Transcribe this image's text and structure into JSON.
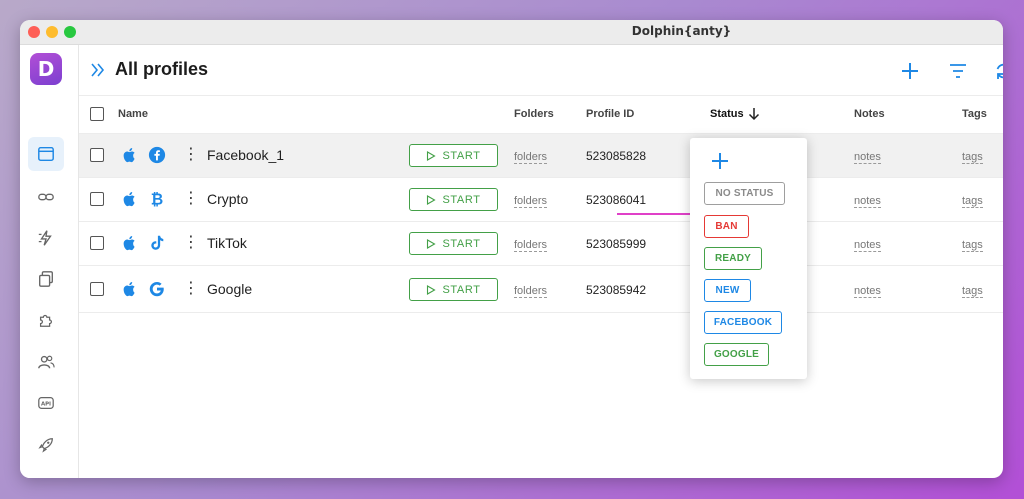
{
  "window": {
    "title": "Dolphin{anty}"
  },
  "sidebar": {
    "logo_letter": "D",
    "items": [
      {
        "icon": "browser-profiles-icon"
      },
      {
        "icon": "link-icon"
      },
      {
        "icon": "automation-icon"
      },
      {
        "icon": "copy-icon"
      },
      {
        "icon": "extension-icon"
      },
      {
        "icon": "users-icon"
      },
      {
        "icon": "api-icon",
        "label": "API"
      },
      {
        "icon": "rocket-icon"
      },
      {
        "icon": "settings-icon"
      }
    ]
  },
  "header": {
    "title": "All profiles"
  },
  "table": {
    "columns": {
      "name": "Name",
      "folders": "Folders",
      "profile_id": "Profile ID",
      "status": "Status",
      "notes": "Notes",
      "tags": "Tags"
    },
    "rows": [
      {
        "name": "Facebook_1",
        "site_icon": "facebook-icon",
        "os_icon": "apple-icon",
        "start": "START",
        "folders": "folders",
        "profile_id": "523085828",
        "notes": "notes",
        "tags": "tags"
      },
      {
        "name": "Crypto",
        "site_icon": "bitcoin-icon",
        "os_icon": "apple-icon",
        "start": "START",
        "folders": "folders",
        "profile_id": "523086041",
        "notes": "notes",
        "tags": "tags"
      },
      {
        "name": "TikTok",
        "site_icon": "tiktok-icon",
        "os_icon": "apple-icon",
        "start": "START",
        "folders": "folders",
        "profile_id": "523085999",
        "notes": "notes",
        "tags": "tags"
      },
      {
        "name": "Google",
        "site_icon": "google-icon",
        "os_icon": "apple-icon",
        "start": "START",
        "folders": "folders",
        "profile_id": "523085942",
        "notes": "notes",
        "tags": "tags"
      }
    ]
  },
  "status_menu": {
    "options": [
      {
        "label": "NO STATUS",
        "color": "#9e9e9e"
      },
      {
        "label": "BAN",
        "color": "#e53935"
      },
      {
        "label": "READY",
        "color": "#43a047"
      },
      {
        "label": "NEW",
        "color": "#1e88e5"
      },
      {
        "label": "FACEBOOK",
        "color": "#1e88e5"
      },
      {
        "label": "GOOGLE",
        "color": "#43a047"
      }
    ]
  },
  "colors": {
    "accent": "#1e88e5",
    "start": "#43a047",
    "annotation_arrow": "#e040c8"
  }
}
